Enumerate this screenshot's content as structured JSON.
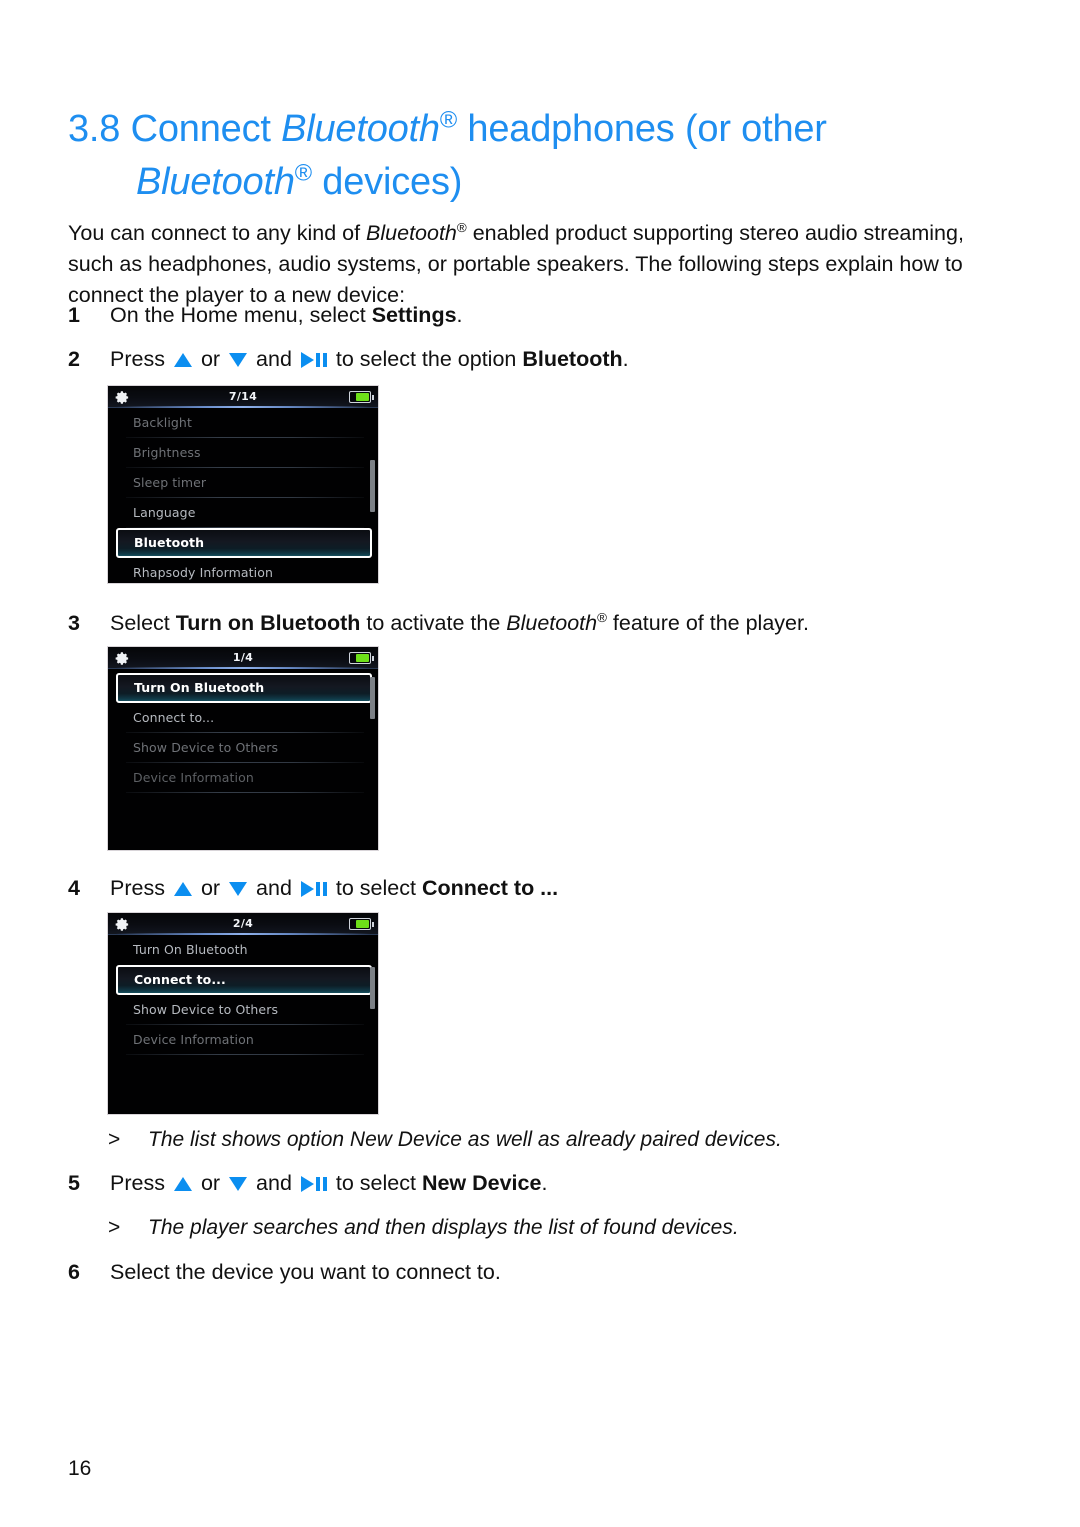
{
  "heading": {
    "number": "3.8",
    "line1_pre": "Connect ",
    "bt": "Bluetooth",
    "line1_post": " headphones (or other",
    "line2_post": " devices)"
  },
  "intro": {
    "part1": "You can connect to any kind of ",
    "bt": "Bluetooth",
    "part2": " enabled product supporting stereo audio streaming, such as headphones, audio systems, or portable speakers. The following steps explain how to connect the player to a new device:"
  },
  "steps": {
    "s1": {
      "marker": "1",
      "pre": "On the Home menu, select ",
      "bold": "Settings",
      "post": "."
    },
    "s2": {
      "marker": "2",
      "press": "Press",
      "or": "or",
      "and": "and",
      "mid": "to select the option",
      "bold": "Bluetooth",
      "post": "."
    },
    "s3": {
      "marker": "3",
      "pre": "Select ",
      "bold": "Turn on Bluetooth",
      "mid": " to activate the ",
      "bt": "Bluetooth",
      "post": " feature of the player."
    },
    "s4": {
      "marker": "4",
      "press": "Press",
      "or": "or",
      "and": "and",
      "mid": "to select",
      "bold": "Connect to ...",
      "post": ""
    },
    "s5": {
      "marker": "5",
      "press": "Press",
      "or": "or",
      "and": "and",
      "mid": "to select",
      "bold": "New Device",
      "post": "."
    },
    "s6": {
      "marker": "6",
      "pre": "Select the device you want to connect to.",
      "bold": "",
      "post": ""
    }
  },
  "notes": {
    "n1": {
      "marker": ">",
      "text": "The list shows option New Device as well as already paired devices."
    },
    "n2": {
      "marker": ">",
      "text": "The player searches and then displays the list of found devices."
    }
  },
  "devices": {
    "d1": {
      "pagecount": "7/14",
      "rows": [
        {
          "label": "Backlight",
          "tone": "dim",
          "selected": false
        },
        {
          "label": "Brightness",
          "tone": "dim",
          "selected": false
        },
        {
          "label": "Sleep timer",
          "tone": "dim",
          "selected": false
        },
        {
          "label": "Language",
          "tone": "mid",
          "selected": false
        },
        {
          "label": "Bluetooth",
          "tone": "bright",
          "selected": true
        },
        {
          "label": "Rhapsody Information",
          "tone": "mid",
          "selected": false
        }
      ]
    },
    "d2": {
      "pagecount": "1/4",
      "rows": [
        {
          "label": "Turn On Bluetooth",
          "tone": "bright",
          "selected": true
        },
        {
          "label": "Connect to...",
          "tone": "mid",
          "selected": false
        },
        {
          "label": "Show Device to Others",
          "tone": "dim",
          "selected": false
        },
        {
          "label": "Device Information",
          "tone": "dimmer",
          "selected": false
        }
      ]
    },
    "d3": {
      "pagecount": "2/4",
      "rows": [
        {
          "label": "Turn On Bluetooth",
          "tone": "mid",
          "selected": false
        },
        {
          "label": "Connect to...",
          "tone": "bright",
          "selected": true
        },
        {
          "label": "Show Device to Others",
          "tone": "mid",
          "selected": false
        },
        {
          "label": "Device Information",
          "tone": "dim",
          "selected": false
        }
      ]
    }
  },
  "footer": {
    "pagenum": "16"
  },
  "colors": {
    "heading_blue": "#1e8ef0",
    "key_blue": "#0b8ef0",
    "battery_green": "#6ee019",
    "selection_teal": "#15505f"
  }
}
